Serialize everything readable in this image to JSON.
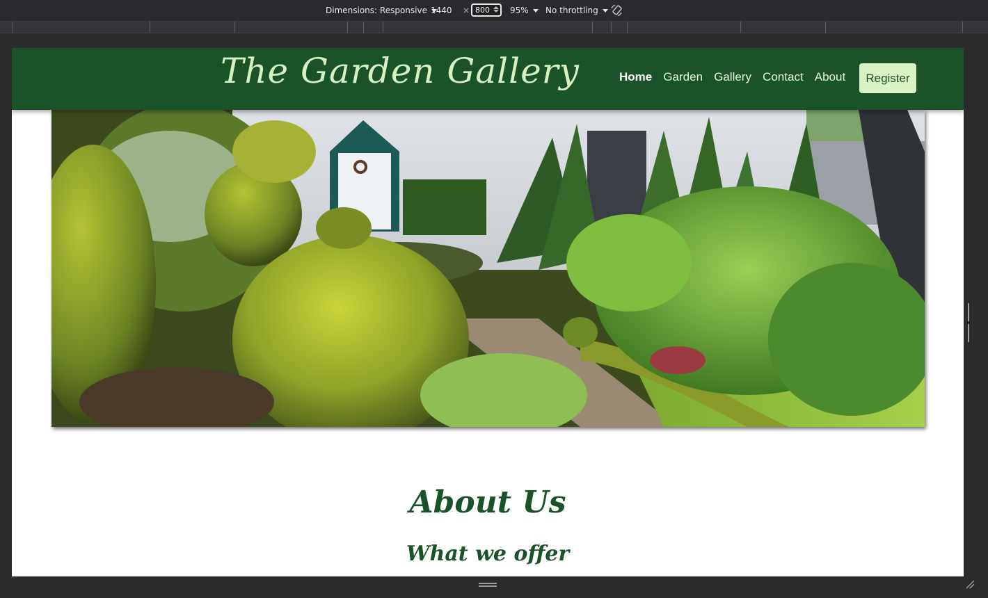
{
  "devtools": {
    "dimensions_label": "Dimensions: Responsive",
    "width": "1440",
    "times": "×",
    "height": "800",
    "zoom": "95%",
    "throttling": "No throttling"
  },
  "site": {
    "brand": "The Garden Gallery",
    "nav": [
      "Home",
      "Garden",
      "Gallery",
      "Contact",
      "About"
    ],
    "register_label": "Register",
    "about_heading": "About Us",
    "about_subheading": "What we offer"
  },
  "colors": {
    "nav_bg": "#1a5229",
    "brand_text": "#d7f0c4",
    "register_bg": "#d9f3c5",
    "heading": "#1a5229"
  },
  "icons": {
    "rotate": "rotate-icon",
    "hero_image": "garden-photo"
  }
}
